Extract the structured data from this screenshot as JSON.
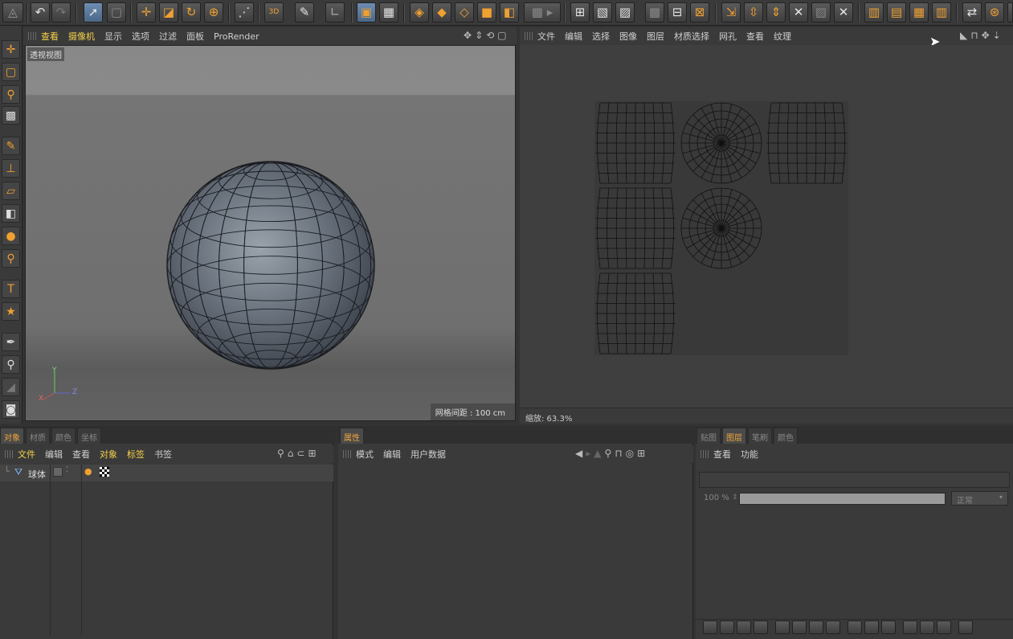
{
  "toolbar": {
    "icons": [
      "undo-icon",
      "redo-icon",
      "select-arrow-icon",
      "live-select-icon",
      "move-icon",
      "scale-icon",
      "rotate-icon",
      "lock-axis-icon",
      "snap-icon",
      "paint-3d-icon",
      "polygon-pen-icon",
      "coordinate-system-icon",
      "model-mode-icon",
      "texture-mode-icon",
      "render-view-icon",
      "render-icon",
      "render-settings-icon",
      "cube-icon",
      "cylinder-icon",
      "plane-icon",
      "grid-icon",
      "uv-points-icon",
      "uv-polygons-icon",
      "uv-select-icon",
      "layout-icon",
      "fit-icon",
      "mirror-icon",
      "flip-icon",
      "split-icon",
      "tile-icon",
      "relax-icon",
      "camera-icon"
    ],
    "paint_3d_label": "3D"
  },
  "viewport": {
    "menu": [
      "查看",
      "摄像机",
      "显示",
      "选项",
      "过滤",
      "面板",
      "ProRender"
    ],
    "label": "透视视图",
    "grid_readout": "网格间距 : 100 cm",
    "axis": {
      "x": "X",
      "y": "Y",
      "z": "Z"
    }
  },
  "uv_editor": {
    "menu": [
      "文件",
      "编辑",
      "选择",
      "图像",
      "图层",
      "材质选择",
      "网孔",
      "查看",
      "纹理"
    ],
    "zoom_status": "缩放: 63.3%"
  },
  "object_manager": {
    "tabs": [
      "对象",
      "材质",
      "颜色",
      "坐标"
    ],
    "menu": [
      "文件",
      "编辑",
      "查看",
      "对象",
      "标签",
      "书签"
    ],
    "objects": [
      {
        "name": "球体"
      }
    ]
  },
  "attributes": {
    "tab": "属性",
    "menu": [
      "模式",
      "编辑",
      "用户数据"
    ]
  },
  "layers": {
    "tabs": [
      "贴图",
      "图层",
      "笔刷",
      "颜色"
    ],
    "menu": [
      "查看",
      "功能"
    ],
    "opacity": "100 %",
    "blend_mode": "正常"
  },
  "colors": {
    "accent": "#f0a030",
    "highlight_text": "#f6d24a",
    "active_tool": "#6f8db2"
  }
}
